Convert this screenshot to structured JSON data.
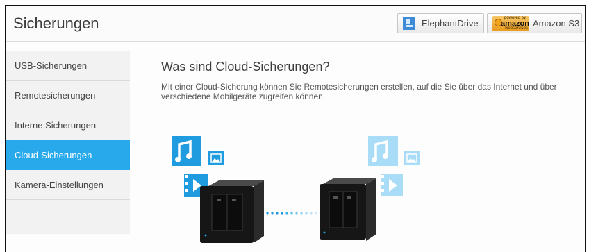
{
  "header": {
    "title": "Sicherungen",
    "services": [
      {
        "label": "ElephantDrive",
        "icon": "elephantdrive-icon"
      },
      {
        "label": "Amazon S3",
        "logo_text": "amazon",
        "logo_top": "powered by",
        "logo_bottom": "webservices"
      }
    ]
  },
  "sidebar": {
    "items": [
      {
        "label": "USB-Sicherungen",
        "active": false
      },
      {
        "label": "Remotesicherungen",
        "active": false
      },
      {
        "label": "Interne Sicherungen",
        "active": false
      },
      {
        "label": "Cloud-Sicherungen",
        "active": true
      },
      {
        "label": "Kamera-Einstellungen",
        "active": false
      }
    ]
  },
  "main": {
    "heading": "Was sind Cloud-Sicherungen?",
    "description": "Mit einer Cloud-Sicherung können Sie Remotesicherungen erstellen, auf die Sie über das Internet und über verschiedene Mobilgeräte zugreifen können."
  },
  "colors": {
    "accent": "#27a9ec",
    "icon_blue": "#1f9be0",
    "icon_faded": "#a9dcf7"
  }
}
